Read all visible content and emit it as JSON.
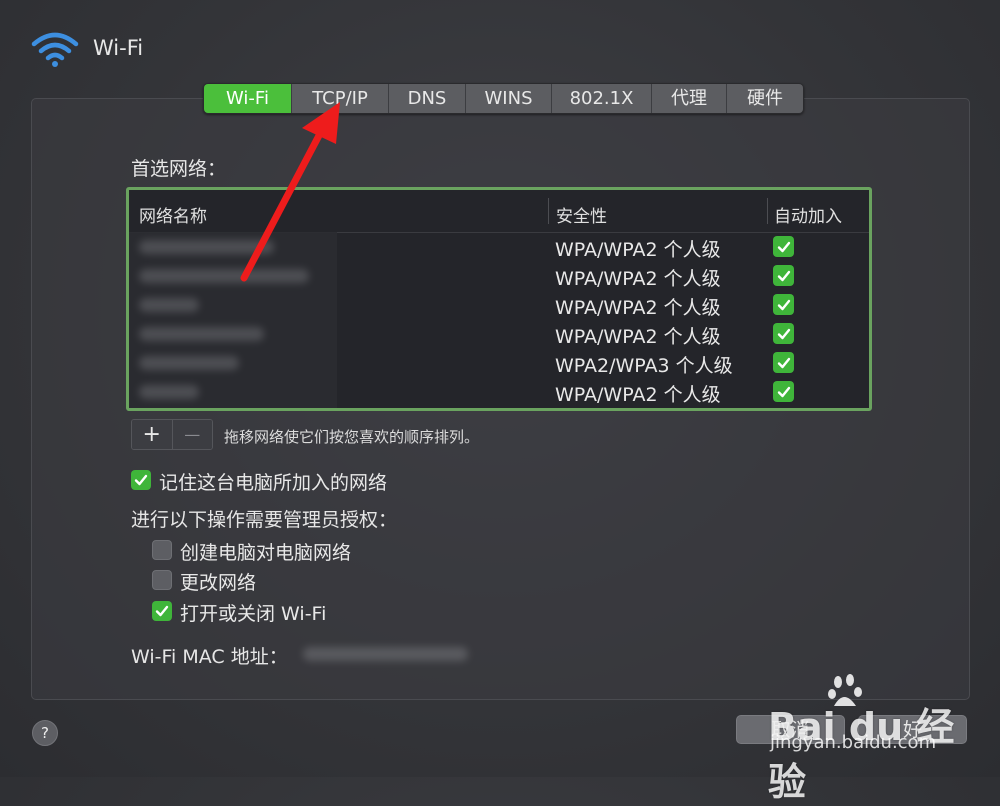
{
  "window": {
    "title": "Wi-Fi"
  },
  "tabs": [
    {
      "label": "Wi-Fi",
      "active": true
    },
    {
      "label": "TCP/IP",
      "active": false
    },
    {
      "label": "DNS",
      "active": false
    },
    {
      "label": "WINS",
      "active": false
    },
    {
      "label": "802.1X",
      "active": false
    },
    {
      "label": "代理",
      "active": false
    },
    {
      "label": "硬件",
      "active": false
    }
  ],
  "preferred_networks": {
    "label": "首选网络：",
    "columns": {
      "name": "网络名称",
      "security": "安全性",
      "auto_join": "自动加入"
    },
    "rows": [
      {
        "security": "WPA/WPA2 个人级",
        "auto_join": true
      },
      {
        "security": "WPA/WPA2 个人级",
        "auto_join": true
      },
      {
        "security": "WPA/WPA2 个人级",
        "auto_join": true
      },
      {
        "security": "WPA/WPA2 个人级",
        "auto_join": true
      },
      {
        "security": "WPA2/WPA3 个人级",
        "auto_join": true
      },
      {
        "security": "WPA/WPA2 个人级",
        "auto_join": true
      }
    ],
    "add_label": "+",
    "remove_label": "—",
    "drag_hint": "拖移网络使它们按您喜欢的顺序排列。"
  },
  "remember_networks": {
    "label": "记住这台电脑所加入的网络",
    "checked": true
  },
  "admin": {
    "label": "进行以下操作需要管理员授权：",
    "options": [
      {
        "label": "创建电脑对电脑网络",
        "checked": false
      },
      {
        "label": "更改网络",
        "checked": false
      },
      {
        "label": "打开或关闭 Wi-Fi",
        "checked": true
      }
    ]
  },
  "mac": {
    "label": "Wi-Fi MAC 地址："
  },
  "help": {
    "label": "?"
  },
  "buttons": {
    "cancel": "取消",
    "ok": "好"
  },
  "watermark": {
    "brand": "Bai du 经验",
    "url": "jingyan.baidu.com"
  },
  "colors": {
    "accent_green": "#4bbf3b",
    "annotation_arrow": "#ee1c1c",
    "table_border": "#6aa35f"
  }
}
